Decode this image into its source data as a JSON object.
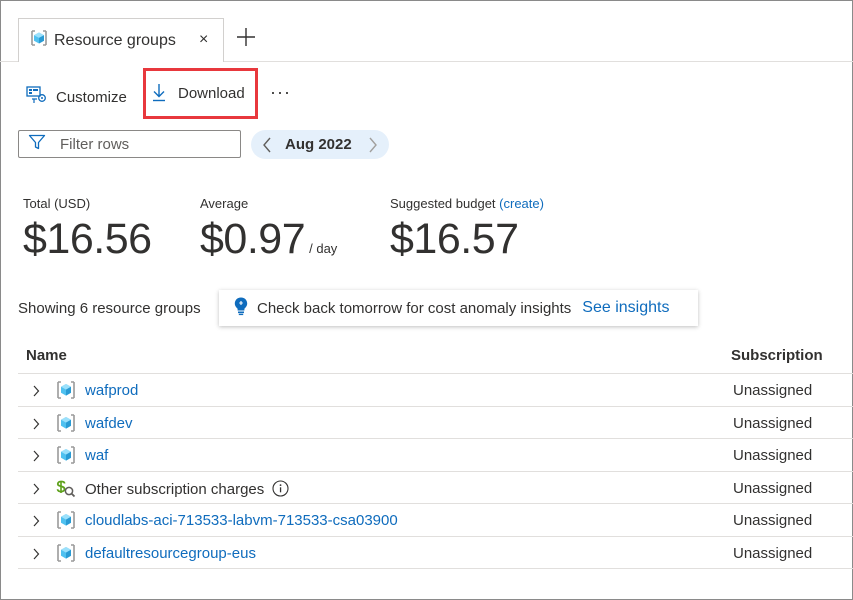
{
  "tab": {
    "label": "Resource groups",
    "close": "×"
  },
  "toolbar": {
    "customize_label": "Customize",
    "download_label": "Download",
    "more_label": "···"
  },
  "filter": {
    "placeholder": "Filter rows",
    "value": ""
  },
  "date": {
    "label": "Aug 2022"
  },
  "kpis": {
    "total": {
      "label": "Total (USD)",
      "value": "$16.56"
    },
    "average": {
      "label": "Average",
      "value": "$0.97",
      "unit": "/ day"
    },
    "budget": {
      "label": "Suggested budget",
      "link": "(create)",
      "value": "$16.57"
    }
  },
  "status": {
    "showing": "Showing 6 resource groups"
  },
  "insight": {
    "message": "Check back tomorrow for cost anomaly insights",
    "link": "See insights"
  },
  "table": {
    "columns": {
      "name": "Name",
      "subscription": "Subscription"
    },
    "rows": [
      {
        "name": "wafprod",
        "subscription": "Unassigned",
        "icon": "resource-group-icon"
      },
      {
        "name": "wafdev",
        "subscription": "Unassigned",
        "icon": "resource-group-icon"
      },
      {
        "name": "waf",
        "subscription": "Unassigned",
        "icon": "resource-group-icon"
      },
      {
        "name": "Other subscription charges",
        "subscription": "Unassigned",
        "icon": "subscription-charges-icon"
      },
      {
        "name": "cloudlabs-aci-713533-labvm-713533-csa03900",
        "subscription": "Unassigned",
        "icon": "resource-group-icon"
      },
      {
        "name": "defaultresourcegroup-eus",
        "subscription": "Unassigned",
        "icon": "resource-group-icon"
      }
    ]
  },
  "colors": {
    "link": "#0f6cbd",
    "highlight_border": "#e8383d",
    "date_pill_bg": "#e5f0fb"
  }
}
